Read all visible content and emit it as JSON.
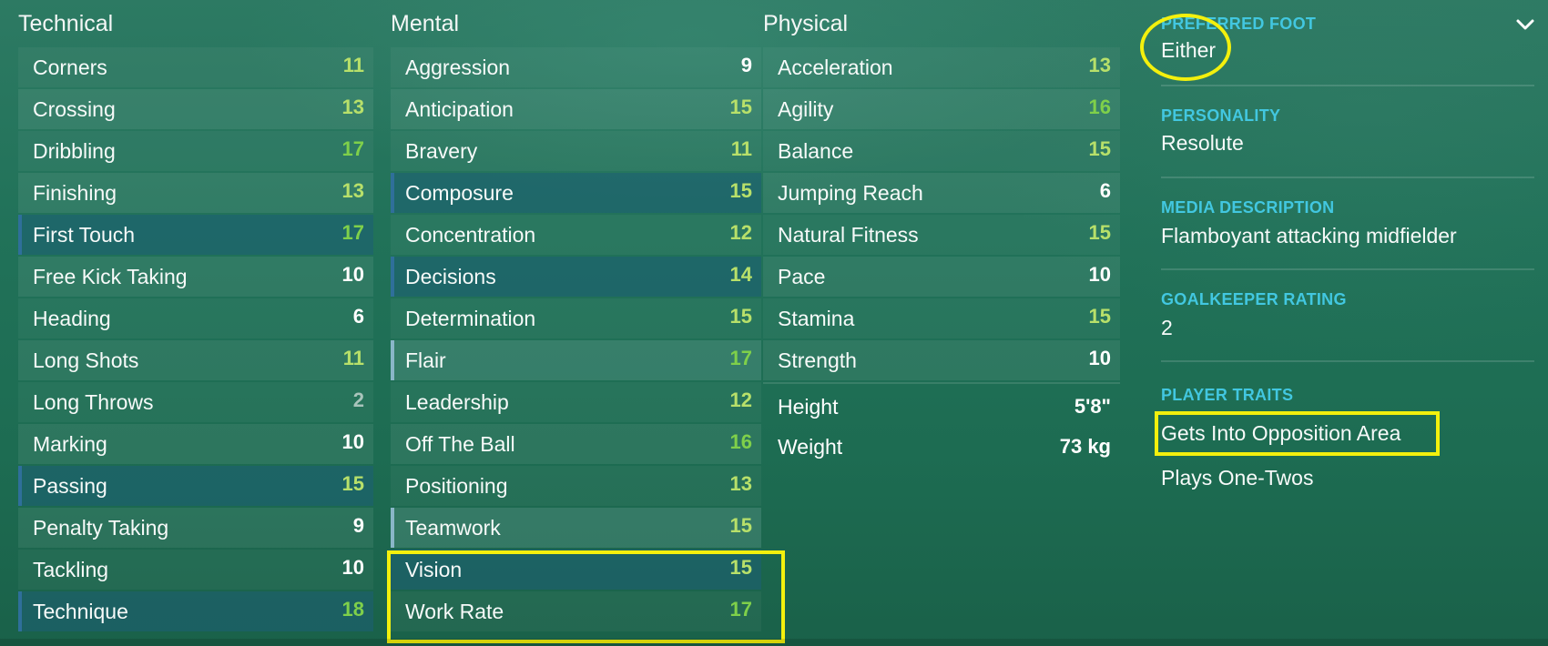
{
  "columns": {
    "technical": {
      "title": "Technical",
      "attributes": [
        {
          "name": "Corners",
          "value": "11"
        },
        {
          "name": "Crossing",
          "value": "13"
        },
        {
          "name": "Dribbling",
          "value": "17"
        },
        {
          "name": "Finishing",
          "value": "13"
        },
        {
          "name": "First Touch",
          "value": "17"
        },
        {
          "name": "Free Kick Taking",
          "value": "10"
        },
        {
          "name": "Heading",
          "value": "6"
        },
        {
          "name": "Long Shots",
          "value": "11"
        },
        {
          "name": "Long Throws",
          "value": "2"
        },
        {
          "name": "Marking",
          "value": "10"
        },
        {
          "name": "Passing",
          "value": "15"
        },
        {
          "name": "Penalty Taking",
          "value": "9"
        },
        {
          "name": "Tackling",
          "value": "10"
        },
        {
          "name": "Technique",
          "value": "18"
        }
      ]
    },
    "mental": {
      "title": "Mental",
      "attributes": [
        {
          "name": "Aggression",
          "value": "9"
        },
        {
          "name": "Anticipation",
          "value": "15"
        },
        {
          "name": "Bravery",
          "value": "11"
        },
        {
          "name": "Composure",
          "value": "15"
        },
        {
          "name": "Concentration",
          "value": "12"
        },
        {
          "name": "Decisions",
          "value": "14"
        },
        {
          "name": "Determination",
          "value": "15"
        },
        {
          "name": "Flair",
          "value": "17"
        },
        {
          "name": "Leadership",
          "value": "12"
        },
        {
          "name": "Off The Ball",
          "value": "16"
        },
        {
          "name": "Positioning",
          "value": "13"
        },
        {
          "name": "Teamwork",
          "value": "15"
        },
        {
          "name": "Vision",
          "value": "15"
        },
        {
          "name": "Work Rate",
          "value": "17"
        }
      ]
    },
    "physical": {
      "title": "Physical",
      "attributes": [
        {
          "name": "Acceleration",
          "value": "13"
        },
        {
          "name": "Agility",
          "value": "16"
        },
        {
          "name": "Balance",
          "value": "15"
        },
        {
          "name": "Jumping Reach",
          "value": "6"
        },
        {
          "name": "Natural Fitness",
          "value": "15"
        },
        {
          "name": "Pace",
          "value": "10"
        },
        {
          "name": "Stamina",
          "value": "15"
        },
        {
          "name": "Strength",
          "value": "10"
        }
      ],
      "measurements": [
        {
          "name": "Height",
          "value": "5'8\""
        },
        {
          "name": "Weight",
          "value": "73 kg"
        }
      ]
    }
  },
  "info": {
    "preferred_foot": {
      "label": "PREFERRED FOOT",
      "value": "Either"
    },
    "personality": {
      "label": "PERSONALITY",
      "value": "Resolute"
    },
    "media_description": {
      "label": "MEDIA DESCRIPTION",
      "value": "Flamboyant attacking midfielder"
    },
    "goalkeeper_rating": {
      "label": "GOALKEEPER RATING",
      "value": "2"
    },
    "player_traits": {
      "label": "PLAYER TRAITS",
      "items": [
        "Gets Into Opposition Area",
        "Plays One-Twos"
      ]
    }
  },
  "icons": {
    "collapse": "chevron-down-icon"
  },
  "colors": {
    "label_accent": "#42c7e0",
    "value_high": "#7fd04a",
    "value_mid": "#b8e06a",
    "value_low": "#a9c4bb",
    "annotation": "#f3f00d"
  }
}
